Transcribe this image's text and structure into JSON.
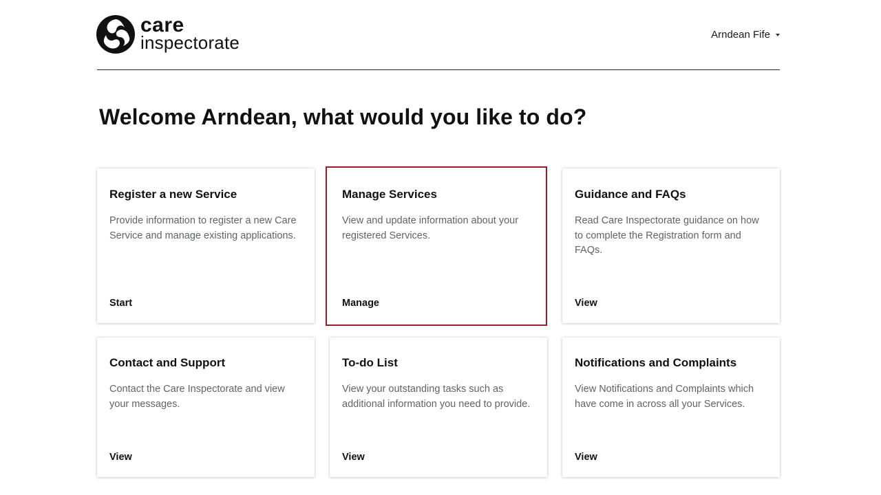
{
  "header": {
    "logo_line1": "care",
    "logo_line2": "inspectorate",
    "user_name": "Arndean Fife"
  },
  "welcome": "Welcome Arndean, what would you like to do?",
  "cards": [
    {
      "title": "Register a new Service",
      "description": "Provide information to register a new Care Service and manage existing applications.",
      "action": "Start"
    },
    {
      "title": "Manage Services",
      "description": "View and update information about your registered Services.",
      "action": "Manage"
    },
    {
      "title": "Guidance and FAQs",
      "description": "Read Care Inspectorate guidance on how to complete the Registration form and FAQs.",
      "action": "View"
    },
    {
      "title": "Contact and Support",
      "description": "Contact the Care Inspectorate and view your messages.",
      "action": "View"
    },
    {
      "title": "To-do List",
      "description": "View your outstanding tasks such as additional information you need to provide.",
      "action": "View"
    },
    {
      "title": "Notifications and Complaints",
      "description": "View Notifications and Complaints which have come in across all your Services.",
      "action": "View"
    }
  ],
  "colors": {
    "selected_border": "#9b1b2a",
    "description_text": "#5f6368"
  }
}
